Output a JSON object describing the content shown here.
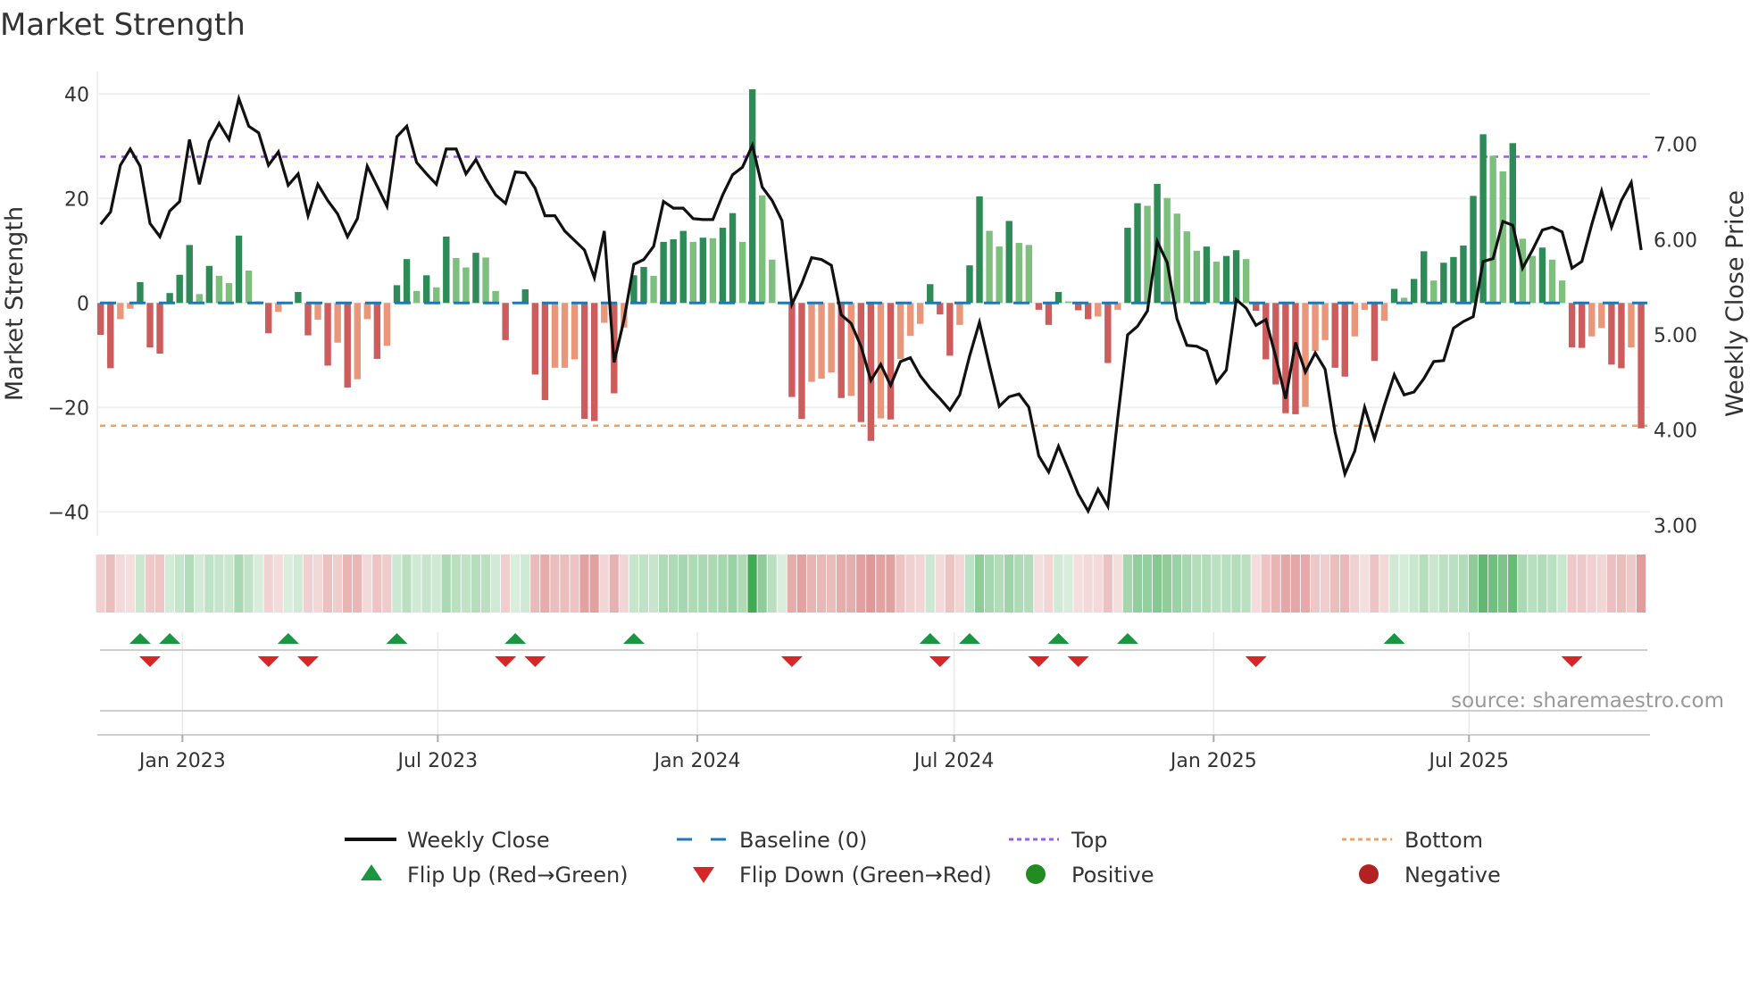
{
  "chart_data": {
    "type": "bar",
    "title": "Market Strength",
    "ylabel": "Market Strength",
    "y2label": "Weekly Close Price",
    "source": "source: sharemaestro.com",
    "ylim": [
      -44,
      44
    ],
    "y2lim": [
      2.95,
      7.65
    ],
    "start_date": "2022-11-04",
    "interval_days": 7,
    "top_level": 28,
    "bottom_level": -23.5,
    "baseline": 0,
    "y_ticks": [
      {
        "value": 40,
        "label": "40"
      },
      {
        "value": 20,
        "label": "20"
      },
      {
        "value": 0,
        "label": "0"
      },
      {
        "value": -20,
        "label": "−20"
      },
      {
        "value": -40,
        "label": "−40"
      }
    ],
    "y2_ticks": [
      {
        "value": 7,
        "label": "7.00"
      },
      {
        "value": 6,
        "label": "6.00"
      },
      {
        "value": 5,
        "label": "5.00"
      },
      {
        "value": 4,
        "label": "4.00"
      },
      {
        "value": 3,
        "label": "3.00"
      }
    ],
    "x_ticks": [
      {
        "date": "2023-01-01",
        "label": "Jan 2023"
      },
      {
        "date": "2023-07-01",
        "label": "Jul 2023"
      },
      {
        "date": "2024-01-01",
        "label": "Jan 2024"
      },
      {
        "date": "2024-07-01",
        "label": "Jul 2024"
      },
      {
        "date": "2025-01-01",
        "label": "Jan 2025"
      },
      {
        "date": "2025-07-01",
        "label": "Jul 2025"
      }
    ],
    "strength": [
      -6.1,
      -12.5,
      -3.1,
      -1.1,
      4.0,
      -8.5,
      -9.7,
      1.9,
      5.4,
      11.1,
      1.7,
      7.1,
      5.2,
      3.8,
      12.9,
      6.2,
      0.3,
      -5.8,
      -1.7,
      0.2,
      2.1,
      -6.2,
      -3.2,
      -12.0,
      -7.6,
      -16.2,
      -14.6,
      -3.1,
      -10.7,
      -8.2,
      3.4,
      8.4,
      2.3,
      5.3,
      3.0,
      12.7,
      8.6,
      6.8,
      9.6,
      8.7,
      2.3,
      -7.1,
      0.2,
      2.6,
      -13.7,
      -18.6,
      -12.4,
      -12.4,
      -10.8,
      -22.2,
      -22.6,
      -3.8,
      -17.3,
      -4.7,
      5.3,
      6.9,
      5.2,
      11.7,
      12.2,
      13.8,
      11.7,
      12.5,
      12.4,
      14.4,
      17.2,
      11.7,
      40.9,
      20.6,
      8.3,
      0.2,
      -18.0,
      -22.2,
      -15.1,
      -14.5,
      -13.3,
      -18.2,
      -17.8,
      -22.8,
      -26.4,
      -22.1,
      -22.3,
      -10.7,
      -6.3,
      -4.0,
      3.6,
      -2.2,
      -10.1,
      -4.2,
      7.2,
      20.4,
      13.8,
      10.8,
      15.7,
      11.5,
      11.1,
      -1.3,
      -4.2,
      2.1,
      0.3,
      -1.4,
      -3.1,
      -2.6,
      -11.5,
      -1.3,
      14.4,
      19.1,
      18.6,
      22.8,
      20.1,
      17.1,
      13.7,
      10.0,
      10.8,
      7.9,
      9.0,
      10.1,
      8.4,
      -1.5,
      -10.8,
      -15.6,
      -21.1,
      -21.3,
      -19.9,
      -9.2,
      -7.1,
      -12.4,
      -14.1,
      -6.4,
      -1.3,
      -11.1,
      -3.4,
      2.7,
      1.0,
      4.6,
      9.9,
      4.3,
      7.7,
      8.8,
      11.0,
      20.5,
      32.3,
      28.2,
      25.2,
      30.6,
      12.3,
      9.0,
      10.6,
      8.3,
      4.3,
      -8.5,
      -8.6,
      -6.4,
      -4.8,
      -11.8,
      -12.5,
      -8.5,
      -24.0
    ],
    "weekly_close": [
      6.16,
      6.29,
      6.78,
      6.95,
      6.77,
      6.17,
      6.03,
      6.3,
      6.4,
      7.05,
      6.58,
      7.03,
      7.22,
      7.05,
      7.48,
      7.19,
      7.12,
      6.78,
      6.92,
      6.57,
      6.69,
      6.25,
      6.58,
      6.41,
      6.27,
      6.03,
      6.22,
      6.77,
      6.56,
      6.35,
      7.08,
      7.19,
      6.81,
      6.69,
      6.58,
      6.95,
      6.95,
      6.69,
      6.84,
      6.64,
      6.47,
      6.38,
      6.71,
      6.7,
      6.54,
      6.25,
      6.25,
      6.09,
      5.99,
      5.89,
      5.6,
      6.09,
      4.71,
      5.16,
      5.74,
      5.79,
      5.93,
      6.4,
      6.33,
      6.33,
      6.22,
      6.21,
      6.21,
      6.47,
      6.68,
      6.76,
      6.99,
      6.55,
      6.41,
      6.2,
      5.32,
      5.54,
      5.81,
      5.79,
      5.73,
      5.21,
      5.12,
      4.88,
      4.52,
      4.69,
      4.47,
      4.72,
      4.76,
      4.57,
      4.44,
      4.33,
      4.21,
      4.37,
      4.78,
      5.13,
      4.68,
      4.25,
      4.35,
      4.38,
      4.24,
      3.73,
      3.56,
      3.83,
      3.58,
      3.33,
      3.15,
      3.38,
      3.2,
      4.13,
      5.0,
      5.09,
      5.25,
      5.98,
      5.76,
      5.17,
      4.89,
      4.88,
      4.83,
      4.5,
      4.63,
      5.37,
      5.28,
      5.1,
      5.16,
      4.77,
      4.33,
      4.92,
      4.61,
      4.81,
      4.64,
      3.98,
      3.54,
      3.78,
      4.24,
      3.91,
      4.26,
      4.58,
      4.37,
      4.4,
      4.54,
      4.72,
      4.73,
      5.07,
      5.14,
      5.19,
      5.77,
      5.8,
      6.19,
      6.15,
      5.7,
      5.89,
      6.1,
      6.13,
      6.08,
      5.7,
      5.77,
      6.16,
      6.51,
      6.13,
      6.41,
      6.6,
      5.89
    ],
    "flip_up_weeks": [
      4,
      7,
      19,
      30,
      42,
      54,
      84,
      88,
      97,
      104,
      131
    ],
    "flip_down_weeks": [
      5,
      17,
      21,
      41,
      44,
      70,
      85,
      95,
      99,
      117,
      149
    ],
    "legend": [
      {
        "label": "Weekly Close",
        "kind": "line"
      },
      {
        "label": "Baseline (0)",
        "kind": "dash"
      },
      {
        "label": "Top",
        "kind": "dot-top"
      },
      {
        "label": "Bottom",
        "kind": "dot-bottom"
      },
      {
        "label": "Flip Up (Red→Green)",
        "kind": "tri-up"
      },
      {
        "label": "Flip Down (Green→Red)",
        "kind": "tri-down"
      },
      {
        "label": "Positive",
        "kind": "circle-pos"
      },
      {
        "label": "Negative",
        "kind": "circle-neg"
      }
    ],
    "legend_position": "bottom",
    "colors": {
      "pos_strong": "#2e8b57",
      "pos_weak": "#7dbf7d",
      "neg_strong": "#cd5c5c",
      "neg_weak": "#e9967a",
      "close": "#111111",
      "baseline": "#1f77b4",
      "top": "#9b5de5",
      "bottom": "#f0a060",
      "flip_up": "#1a9641",
      "flip_down": "#d62728",
      "positive": "#228b22",
      "negative": "#b22222"
    }
  }
}
